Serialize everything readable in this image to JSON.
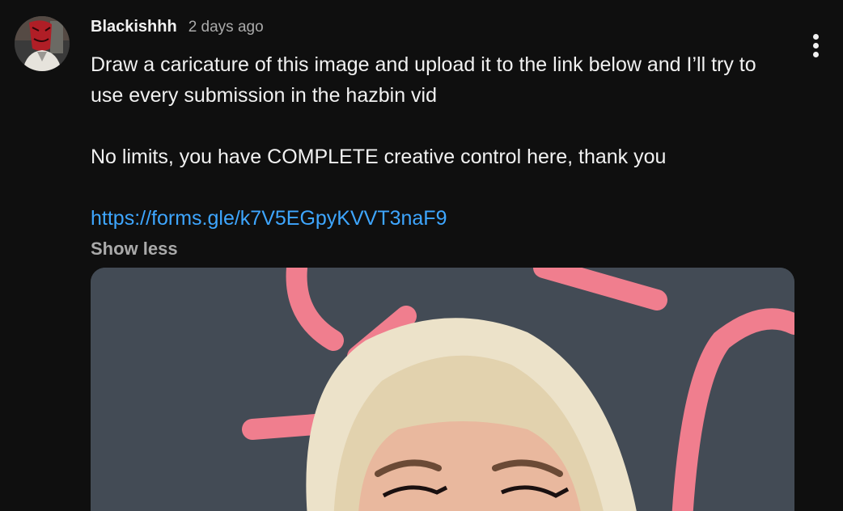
{
  "comment": {
    "author": "Blackishhh",
    "timestamp": "2 days ago",
    "paragraphs": [
      "Draw a caricature of this image and upload it to the link below and I’ll try to use every submission in the hazbin vid",
      "No limits, you have COMPLETE creative control here, thank you"
    ],
    "link_text": "https://forms.gle/k7V5EGpyKVVT3naF9",
    "show_less_label": "Show less"
  },
  "icons": {
    "avatar": "avatar-image",
    "menu": "more-vertical-icon"
  },
  "colors": {
    "background": "#0f0f0f",
    "text": "#f1f1f1",
    "muted": "#aaaaaa",
    "link": "#3ea6ff"
  }
}
